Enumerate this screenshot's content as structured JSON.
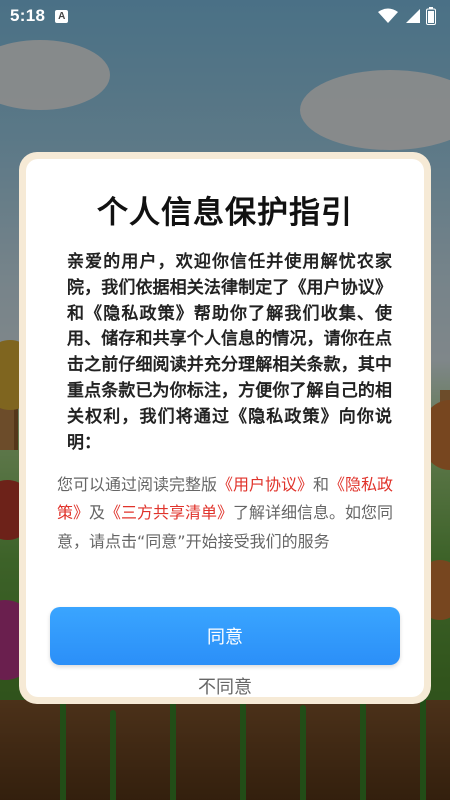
{
  "status_bar": {
    "time": "5:18",
    "notification_icon_letter": "A",
    "icons": [
      "wifi-icon",
      "signal-icon",
      "battery-icon"
    ]
  },
  "dialog": {
    "title": "个人信息保护指引",
    "main_text": "亲爱的用户，欢迎你信任并使用解忧农家院，我们依据相关法律制定了《用户协议》和《隐私政策》帮助你了解我们收集、使用、储存和共享个人信息的情况，请你在点击之前仔细阅读并充分理解相关条款，其中重点条款已为你标注，方便你了解自己的相关权利，我们将通过《隐私政策》向你说明：",
    "sub_text": {
      "part1": "您可以通过阅读完整版",
      "link_user_agreement": "《用户协议》",
      "part2": "和",
      "link_privacy_policy": "《隐私政策》",
      "part3": "及",
      "link_sharing_list": "《三方共享清单》",
      "part4": "了解详细信息。如您同意，请点击“同意”开始接受我们的服务"
    },
    "agree_label": "同意",
    "disagree_label": "不同意"
  },
  "colors": {
    "link": "#e0332b",
    "button": "#2b8ff8",
    "dialog_border": "#f6ead6"
  }
}
